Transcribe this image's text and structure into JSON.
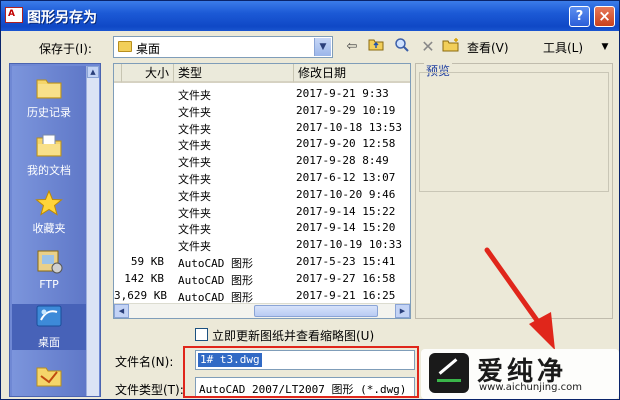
{
  "window": {
    "title": "图形另存为"
  },
  "save_in": {
    "label": "保存于(I):",
    "value": "桌面"
  },
  "toolbar": {
    "view_label": "查看(V)",
    "tools_label": "工具(L)"
  },
  "places": [
    {
      "label": "历史记录",
      "icon": "folder-history-icon"
    },
    {
      "label": "我的文档",
      "icon": "my-documents-icon"
    },
    {
      "label": "收藏夹",
      "icon": "favorites-star-icon"
    },
    {
      "label": "FTP",
      "icon": "ftp-icon"
    },
    {
      "label": "桌面",
      "icon": "desktop-icon"
    }
  ],
  "columns": {
    "size": "大小",
    "type": "类型",
    "date": "修改日期"
  },
  "files": [
    {
      "size": "",
      "type": "文件夹",
      "date": "2017-9-21 9:33"
    },
    {
      "size": "",
      "type": "文件夹",
      "date": "2017-9-29 10:19"
    },
    {
      "size": "",
      "type": "文件夹",
      "date": "2017-10-18 13:53"
    },
    {
      "size": "",
      "type": "文件夹",
      "date": "2017-9-20 12:58"
    },
    {
      "size": "",
      "type": "文件夹",
      "date": "2017-9-28 8:49"
    },
    {
      "size": "",
      "type": "文件夹",
      "date": "2017-6-12 13:07"
    },
    {
      "size": "",
      "type": "文件夹",
      "date": "2017-10-20 9:46"
    },
    {
      "size": "",
      "type": "文件夹",
      "date": "2017-9-14 15:22"
    },
    {
      "size": "",
      "type": "文件夹",
      "date": "2017-9-14 15:20"
    },
    {
      "size": "",
      "type": "文件夹",
      "date": "2017-10-19 10:33"
    },
    {
      "size": "59 KB",
      "type": "AutoCAD 图形",
      "date": "2017-5-23 15:41"
    },
    {
      "size": "142 KB",
      "type": "AutoCAD 图形",
      "date": "2017-9-27 16:58"
    },
    {
      "size": "3,629 KB",
      "type": "AutoCAD 图形",
      "date": "2017-9-21 16:25"
    }
  ],
  "preview": {
    "label": "预览"
  },
  "update_thumbnail": {
    "label": "立即更新图纸并查看缩略图(U)"
  },
  "file_name": {
    "label": "文件名(N):",
    "value": "1# t3.dwg"
  },
  "file_type": {
    "label": "文件类型(T):",
    "value": "AutoCAD 2007/LT2007 图形 (*.dwg)"
  },
  "watermark": {
    "title": "爱纯净",
    "url": "www.aichunjing.com"
  },
  "colors": {
    "titlebar": "#1c5ad6",
    "places_bar": "#6f88d4",
    "highlight": "#e0261b",
    "selection": "#316ac5"
  }
}
